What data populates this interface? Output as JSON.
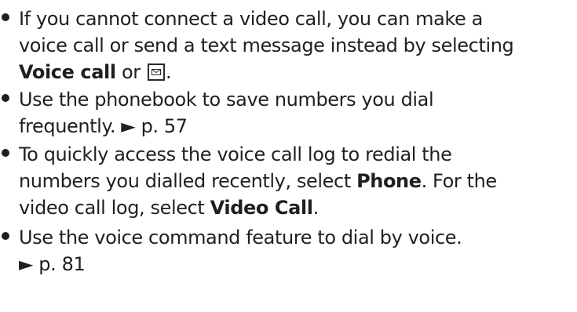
{
  "tips": [
    {
      "line1": "If you cannot connect a video call, you can make a",
      "line2": "voice call or send a text message instead by selecting",
      "bold_voice_call": "Voice call",
      "or_text": " or ",
      "icon": "message-envelope-icon",
      "end_punct": "."
    },
    {
      "line1": "Use the phonebook to save numbers you dial",
      "line2": "frequently. ► p. 57"
    },
    {
      "line1": "To quickly access the voice call log to redial the",
      "line2_before": "numbers you dialled recently, select ",
      "bold_phone": "Phone",
      "line2_after": ". For the",
      "line3_before": "video call log, select ",
      "bold_video_call": "Video Call",
      "line3_after": "."
    },
    {
      "line1": "Use the voice command feature to dial by voice.",
      "line2": "► p. 81"
    }
  ]
}
